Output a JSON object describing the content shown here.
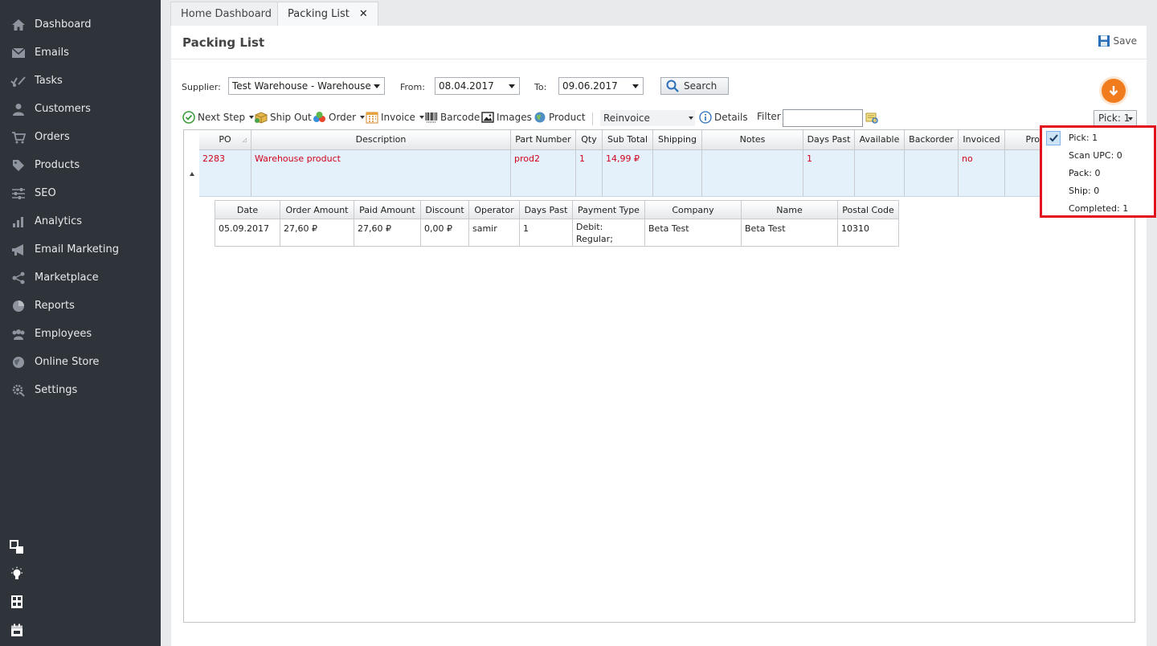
{
  "sidebar": {
    "items": [
      {
        "label": "Dashboard",
        "icon": "home-icon"
      },
      {
        "label": "Emails",
        "icon": "envelope-icon"
      },
      {
        "label": "Tasks",
        "icon": "tasks-icon"
      },
      {
        "label": "Customers",
        "icon": "user-icon"
      },
      {
        "label": "Orders",
        "icon": "cart-icon"
      },
      {
        "label": "Products",
        "icon": "tag-icon"
      },
      {
        "label": "SEO",
        "icon": "sliders-icon"
      },
      {
        "label": "Analytics",
        "icon": "bar-chart-icon"
      },
      {
        "label": "Email Marketing",
        "icon": "megaphone-icon"
      },
      {
        "label": "Marketplace",
        "icon": "share-icon"
      },
      {
        "label": "Reports",
        "icon": "pie-chart-icon"
      },
      {
        "label": "Employees",
        "icon": "users-icon"
      },
      {
        "label": "Online Store",
        "icon": "globe-icon"
      },
      {
        "label": "Settings",
        "icon": "gear-search-icon"
      }
    ]
  },
  "tabs": [
    {
      "label": "Home Dashboard"
    },
    {
      "label": "Packing List",
      "close": "✕"
    }
  ],
  "header": {
    "title": "Packing List",
    "save_label": "Save"
  },
  "filters": {
    "supplier_label": "Supplier:",
    "supplier_value": "Test Warehouse - Warehouse",
    "from_label": "From:",
    "from_value": "08.04.2017",
    "to_label": "To:",
    "to_value": "09.06.2017",
    "search_label": "Search"
  },
  "toolbar": {
    "next_step": "Next Step",
    "ship_out": "Ship Out",
    "order": "Order",
    "invoice": "Invoice",
    "barcode": "Barcode",
    "images": "Images",
    "product": "Product",
    "reinvoice": "Reinvoice",
    "details": "Details",
    "filter_label": "Filter",
    "filter_value": "",
    "pick_label": "Pick: 1"
  },
  "grid": {
    "columns": [
      "PO",
      "Description",
      "Part Number",
      "Qty",
      "Sub Total",
      "Shipping",
      "Notes",
      "Days Past",
      "Available",
      "Backorder",
      "Invoiced",
      "Pro"
    ],
    "row": {
      "po": "2283",
      "description": "Warehouse product",
      "part_number": "prod2",
      "qty": "1",
      "sub_total": "14,99 ₽",
      "shipping": "",
      "notes": "",
      "days_past": "1",
      "available": "",
      "backorder": "",
      "invoiced": "no",
      "pro": ""
    },
    "detail_columns": [
      "Date",
      "Order Amount",
      "Paid Amount",
      "Discount",
      "Operator",
      "Days Past",
      "Payment Type",
      "Company",
      "Name",
      "Postal Code"
    ],
    "detail_row": {
      "date": "05.09.2017",
      "order_amount": "27,60 ₽",
      "paid_amount": "27,60 ₽",
      "discount": "0,00 ₽",
      "operator": "samir",
      "days_past": "1",
      "payment_type": "Debit: Regular; Charges: Cash",
      "company": "Beta Test",
      "name": "Beta Test",
      "postal_code": "10310"
    }
  },
  "pick_menu": {
    "items": [
      "Pick: 1",
      "Scan UPC: 0",
      "Pack: 0",
      "Ship: 0",
      "Completed: 1"
    ],
    "selected_index": 0
  },
  "colors": {
    "sidebar_bg": "#2f343b",
    "accent_orange": "#f07c1e",
    "highlight_red": "#e3101d",
    "row_text_red": "#d0021b",
    "row_bg": "#e4f1fb"
  }
}
